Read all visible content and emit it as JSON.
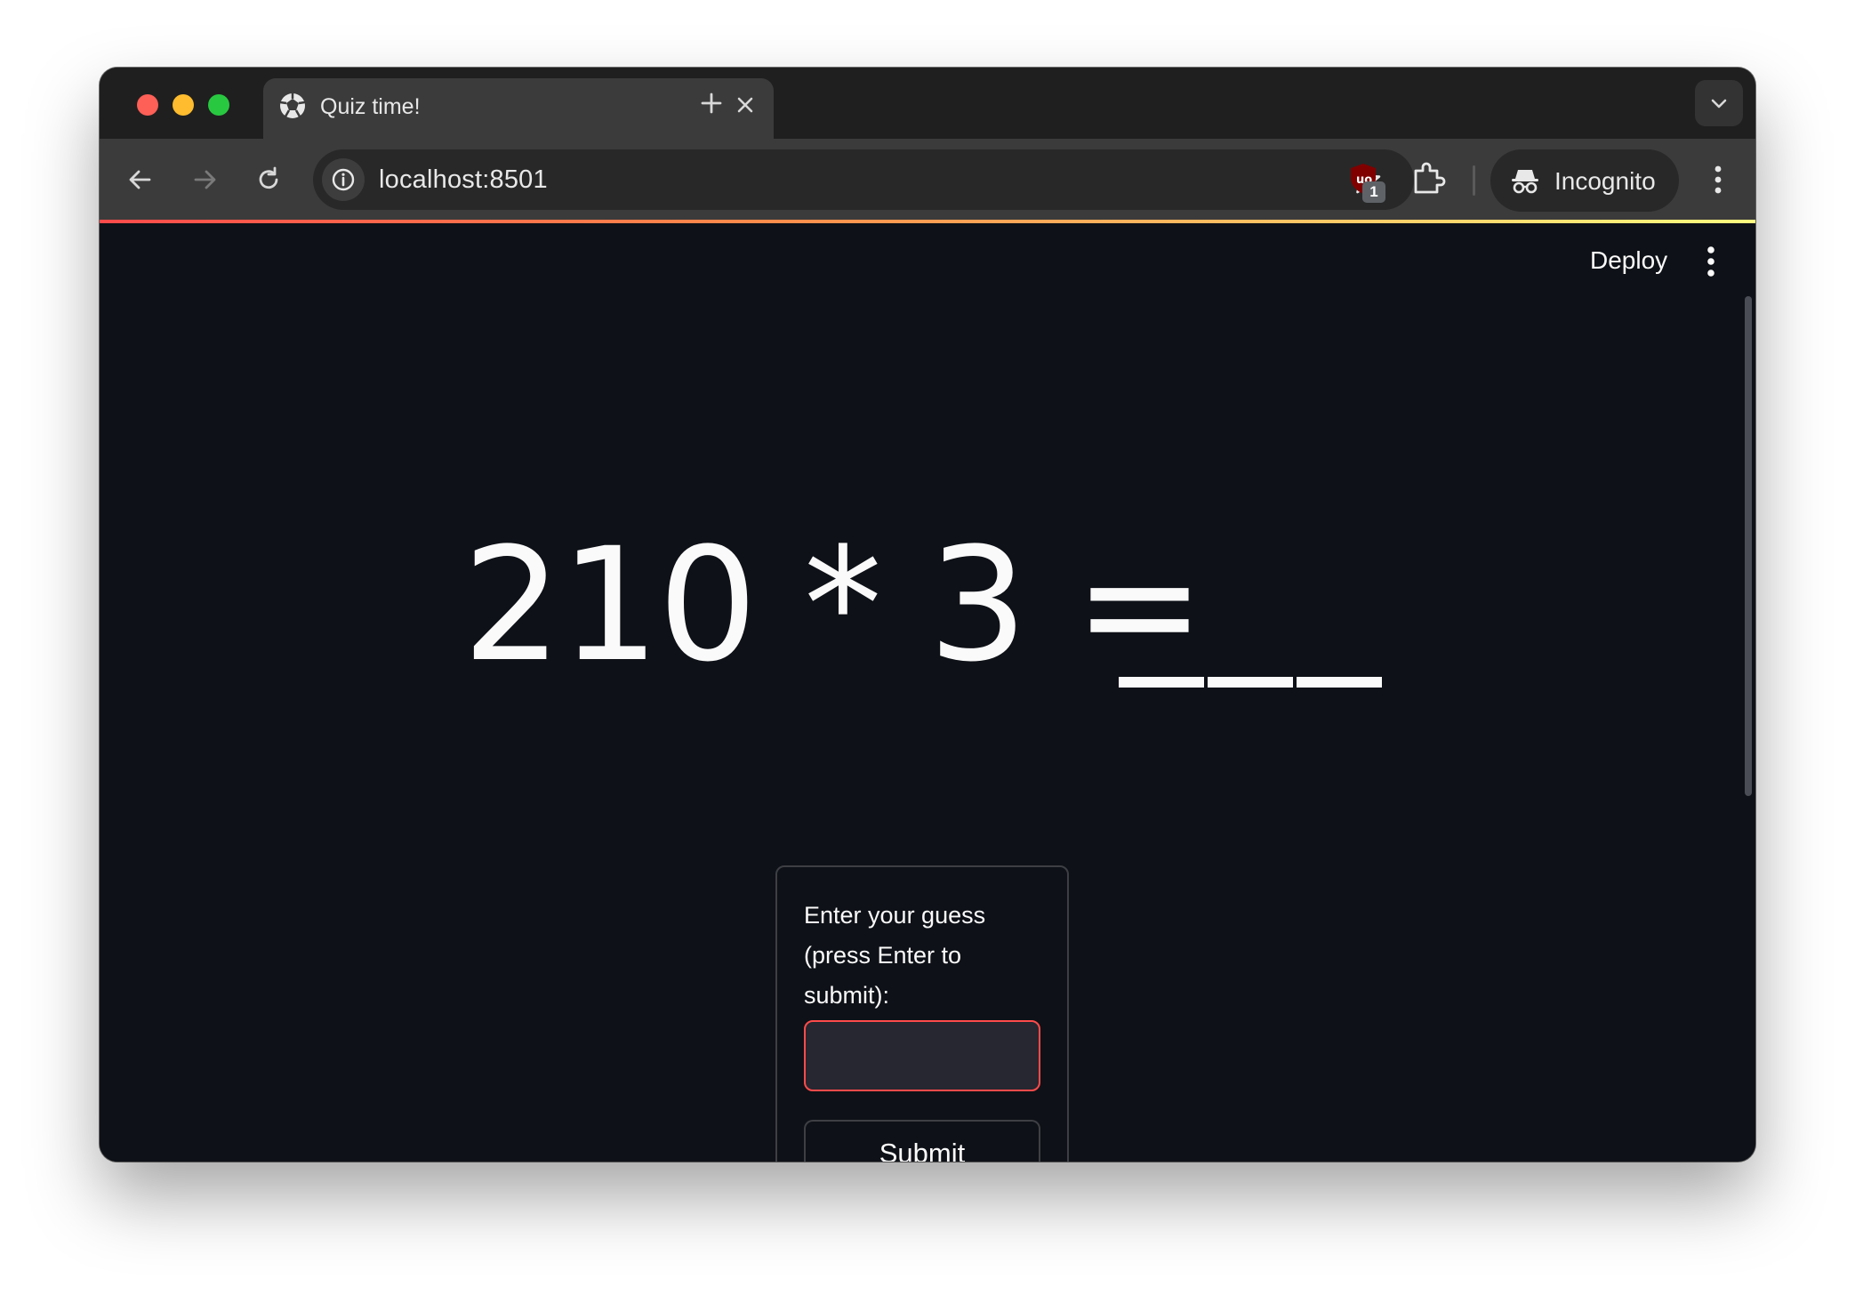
{
  "browser": {
    "tab": {
      "title": "Quiz time!",
      "icon": "streamlit-logo-icon"
    },
    "address_bar": {
      "url": "localhost:8501"
    },
    "extensions": {
      "ublock_badge": "1"
    },
    "profile": {
      "label": "Incognito"
    }
  },
  "app": {
    "header": {
      "deploy_label": "Deploy"
    },
    "question": {
      "equation": "210 * 3 =",
      "blank_count": 3
    },
    "form": {
      "label": "Enter your guess (press Enter to submit):",
      "input_value": "",
      "input_placeholder": "",
      "submit_label": "Submit"
    }
  },
  "colors": {
    "app_background": "#0e1117",
    "input_border_focus": "#ff4b4b",
    "text": "#fafafa"
  }
}
